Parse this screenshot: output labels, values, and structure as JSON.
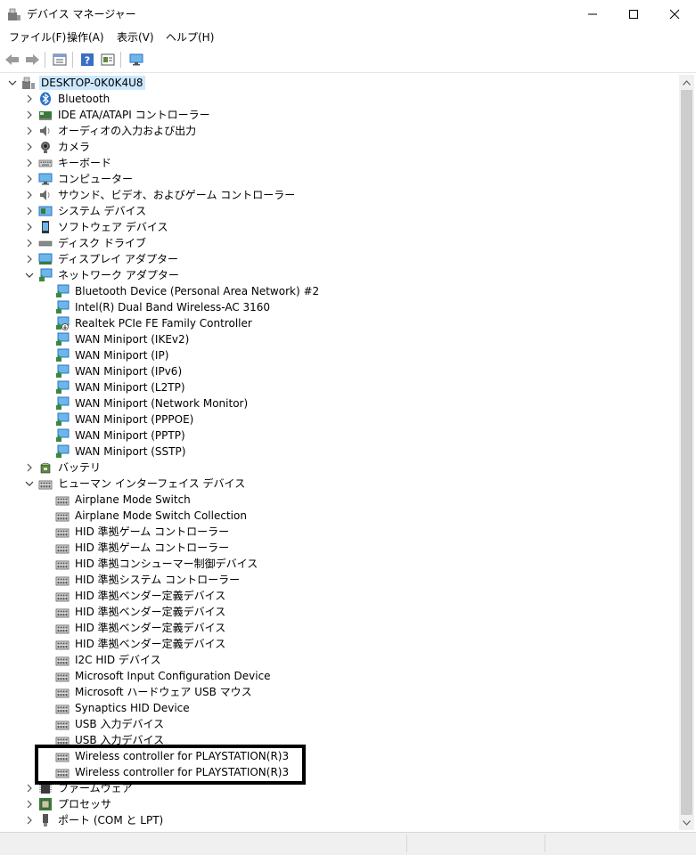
{
  "window": {
    "title": "デバイス マネージャー",
    "app_icon": "device-manager-icon",
    "controls": {
      "minimize": "─",
      "maximize": "☐",
      "close": "✕"
    }
  },
  "menu": {
    "items": [
      "ファイル(F)",
      "操作(A)",
      "表示(V)",
      "ヘルプ(H)"
    ]
  },
  "toolbar": {
    "buttons": [
      "back-arrow-icon",
      "forward-arrow-icon",
      "properties-icon",
      "help-icon",
      "show-hidden-icon",
      "monitor-icon"
    ]
  },
  "tree": {
    "root": {
      "label": "DESKTOP-0K0K4U8",
      "icon": "computer-icon",
      "expanded": true
    },
    "rows": [
      {
        "label": "Bluetooth",
        "icon": "bluetooth-icon",
        "level": 1,
        "expander": "collapsed"
      },
      {
        "label": "IDE ATA/ATAPI コントローラー",
        "icon": "ide-controller-icon",
        "level": 1,
        "expander": "collapsed"
      },
      {
        "label": "オーディオの入力および出力",
        "icon": "speaker-icon",
        "level": 1,
        "expander": "collapsed"
      },
      {
        "label": "カメラ",
        "icon": "camera-icon",
        "level": 1,
        "expander": "collapsed"
      },
      {
        "label": "キーボード",
        "icon": "keyboard-icon",
        "level": 1,
        "expander": "collapsed"
      },
      {
        "label": "コンピューター",
        "icon": "monitor-icon",
        "level": 1,
        "expander": "collapsed"
      },
      {
        "label": "サウンド、ビデオ、およびゲーム コントローラー",
        "icon": "speaker-icon",
        "level": 1,
        "expander": "collapsed"
      },
      {
        "label": "システム デバイス",
        "icon": "system-device-icon",
        "level": 1,
        "expander": "collapsed"
      },
      {
        "label": "ソフトウェア デバイス",
        "icon": "software-device-icon",
        "level": 1,
        "expander": "collapsed"
      },
      {
        "label": "ディスク ドライブ",
        "icon": "disk-drive-icon",
        "level": 1,
        "expander": "collapsed"
      },
      {
        "label": "ディスプレイ アダプター",
        "icon": "display-adapter-icon",
        "level": 1,
        "expander": "collapsed"
      },
      {
        "label": "ネットワーク アダプター",
        "icon": "network-icon",
        "level": 1,
        "expander": "expanded"
      },
      {
        "label": "Bluetooth Device (Personal Area Network) #2",
        "icon": "network-icon",
        "level": 2,
        "expander": "none"
      },
      {
        "label": "Intel(R) Dual Band Wireless-AC 3160",
        "icon": "network-icon",
        "level": 2,
        "expander": "none"
      },
      {
        "label": "Realtek PCIe FE Family Controller",
        "icon": "network-disabled-icon",
        "level": 2,
        "expander": "none"
      },
      {
        "label": "WAN Miniport (IKEv2)",
        "icon": "network-icon",
        "level": 2,
        "expander": "none"
      },
      {
        "label": "WAN Miniport (IP)",
        "icon": "network-icon",
        "level": 2,
        "expander": "none"
      },
      {
        "label": "WAN Miniport (IPv6)",
        "icon": "network-icon",
        "level": 2,
        "expander": "none"
      },
      {
        "label": "WAN Miniport (L2TP)",
        "icon": "network-icon",
        "level": 2,
        "expander": "none"
      },
      {
        "label": "WAN Miniport (Network Monitor)",
        "icon": "network-icon",
        "level": 2,
        "expander": "none"
      },
      {
        "label": "WAN Miniport (PPPOE)",
        "icon": "network-icon",
        "level": 2,
        "expander": "none"
      },
      {
        "label": "WAN Miniport (PPTP)",
        "icon": "network-icon",
        "level": 2,
        "expander": "none"
      },
      {
        "label": "WAN Miniport (SSTP)",
        "icon": "network-icon",
        "level": 2,
        "expander": "none"
      },
      {
        "label": "バッテリ",
        "icon": "battery-icon",
        "level": 1,
        "expander": "collapsed"
      },
      {
        "label": "ヒューマン インターフェイス デバイス",
        "icon": "hid-icon",
        "level": 1,
        "expander": "expanded"
      },
      {
        "label": "Airplane Mode Switch",
        "icon": "hid-icon",
        "level": 2,
        "expander": "none"
      },
      {
        "label": "Airplane Mode Switch Collection",
        "icon": "hid-icon",
        "level": 2,
        "expander": "none"
      },
      {
        "label": "HID 準拠ゲーム コントローラー",
        "icon": "hid-icon",
        "level": 2,
        "expander": "none"
      },
      {
        "label": "HID 準拠ゲーム コントローラー",
        "icon": "hid-icon",
        "level": 2,
        "expander": "none"
      },
      {
        "label": "HID 準拠コンシューマー制御デバイス",
        "icon": "hid-icon",
        "level": 2,
        "expander": "none"
      },
      {
        "label": "HID 準拠システム コントローラー",
        "icon": "hid-icon",
        "level": 2,
        "expander": "none"
      },
      {
        "label": "HID 準拠ベンダー定義デバイス",
        "icon": "hid-icon",
        "level": 2,
        "expander": "none"
      },
      {
        "label": "HID 準拠ベンダー定義デバイス",
        "icon": "hid-icon",
        "level": 2,
        "expander": "none"
      },
      {
        "label": "HID 準拠ベンダー定義デバイス",
        "icon": "hid-icon",
        "level": 2,
        "expander": "none"
      },
      {
        "label": "HID 準拠ベンダー定義デバイス",
        "icon": "hid-icon",
        "level": 2,
        "expander": "none"
      },
      {
        "label": "I2C HID デバイス",
        "icon": "hid-icon",
        "level": 2,
        "expander": "none"
      },
      {
        "label": "Microsoft Input Configuration Device",
        "icon": "hid-icon",
        "level": 2,
        "expander": "none"
      },
      {
        "label": "Microsoft ハードウェア USB マウス",
        "icon": "hid-icon",
        "level": 2,
        "expander": "none"
      },
      {
        "label": "Synaptics HID Device",
        "icon": "hid-icon",
        "level": 2,
        "expander": "none"
      },
      {
        "label": "USB 入力デバイス",
        "icon": "hid-icon",
        "level": 2,
        "expander": "none"
      },
      {
        "label": "USB 入力デバイス",
        "icon": "hid-icon",
        "level": 2,
        "expander": "none"
      },
      {
        "label": "Wireless controller for PLAYSTATION(R)3",
        "icon": "hid-icon",
        "level": 2,
        "expander": "none"
      },
      {
        "label": "Wireless controller for PLAYSTATION(R)3",
        "icon": "hid-icon",
        "level": 2,
        "expander": "none"
      },
      {
        "label": "ファームウェア",
        "icon": "firmware-icon",
        "level": 1,
        "expander": "collapsed"
      },
      {
        "label": "プロセッサ",
        "icon": "processor-icon",
        "level": 1,
        "expander": "collapsed"
      },
      {
        "label": "ポート (COM と LPT)",
        "icon": "port-icon",
        "level": 1,
        "expander": "collapsed"
      }
    ]
  },
  "colors": {
    "accent_blue": "#2b70c9",
    "selection_bg": "#cce8ff",
    "highlight_box": "#000000"
  }
}
